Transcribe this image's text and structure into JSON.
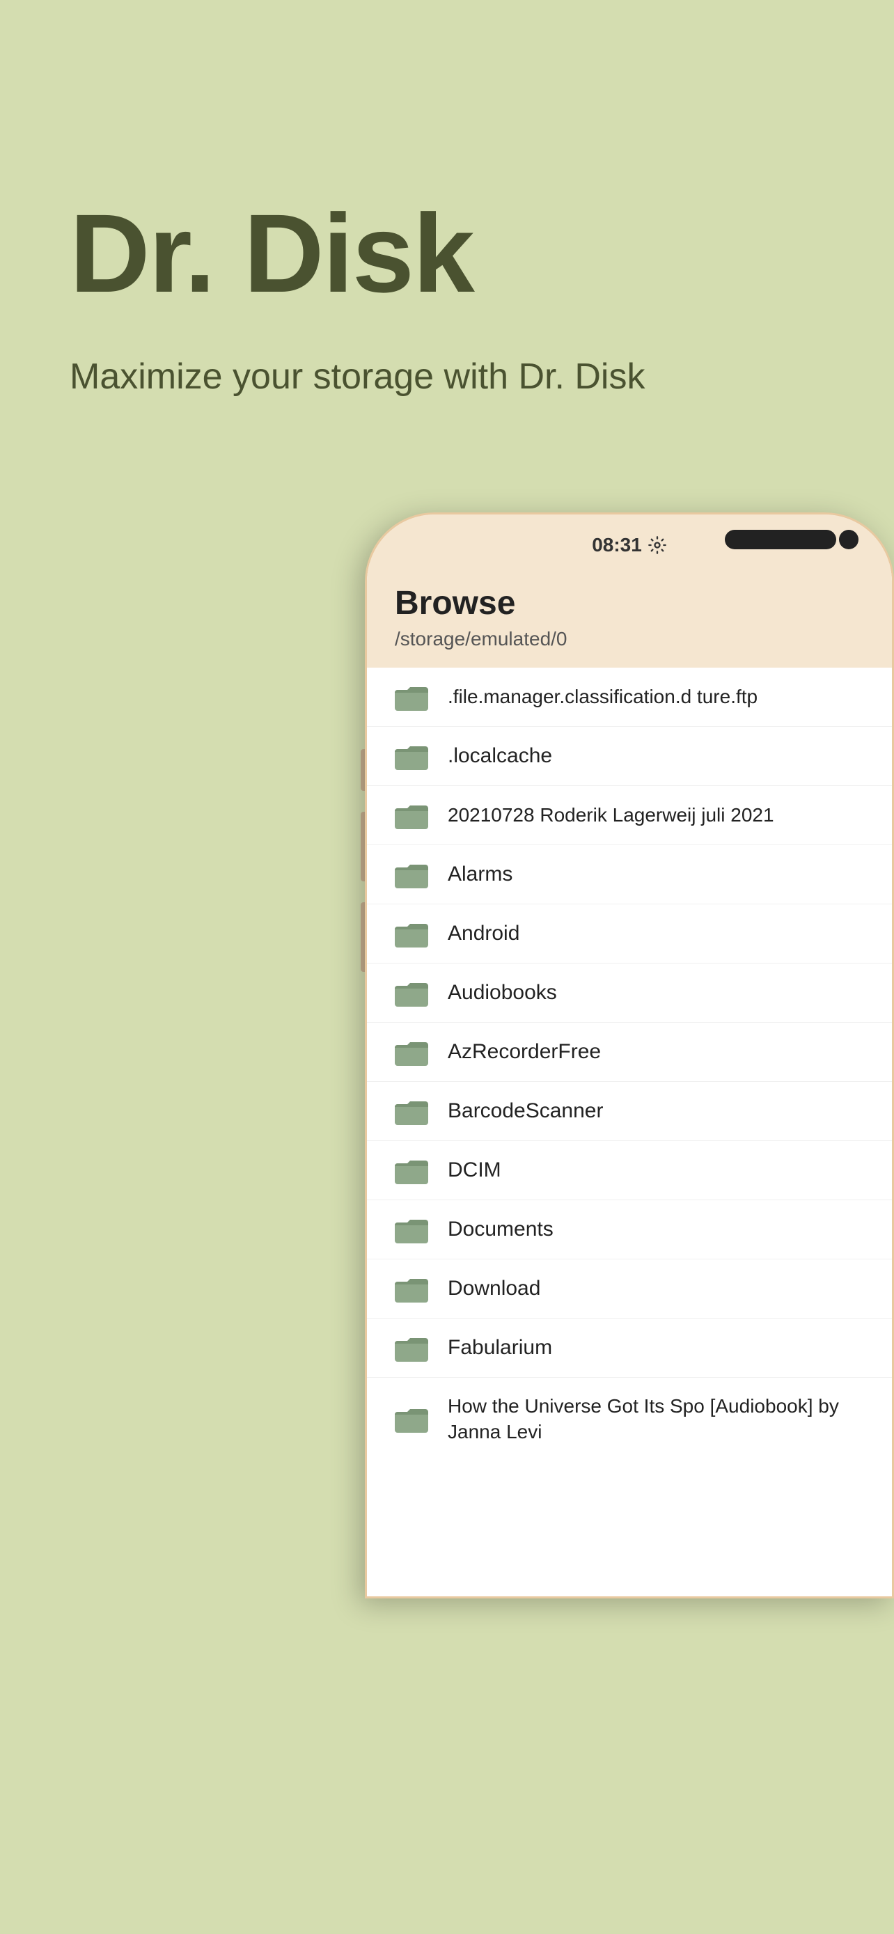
{
  "hero": {
    "title": "Dr. Disk",
    "subtitle": "Maximize your storage with Dr. Disk"
  },
  "phone": {
    "status_time": "08:31",
    "screen": {
      "browse_title": "Browse",
      "browse_path": "/storage/emulated/0",
      "files": [
        {
          "name": ".file.manager.classification.d\nture.ftp",
          "multiline": true
        },
        {
          "name": ".localcache",
          "multiline": false
        },
        {
          "name": "20210728 Roderik Lagerweij\njuli 2021",
          "multiline": true
        },
        {
          "name": "Alarms",
          "multiline": false
        },
        {
          "name": "Android",
          "multiline": false
        },
        {
          "name": "Audiobooks",
          "multiline": false
        },
        {
          "name": "AzRecorderFree",
          "multiline": false
        },
        {
          "name": "BarcodeScanner",
          "multiline": false
        },
        {
          "name": "DCIM",
          "multiline": false
        },
        {
          "name": "Documents",
          "multiline": false
        },
        {
          "name": "Download",
          "multiline": false
        },
        {
          "name": "Fabularium",
          "multiline": false
        },
        {
          "name": "How the Universe Got Its Spo\n[Audiobook] by Janna Levi",
          "multiline": true
        }
      ]
    }
  },
  "colors": {
    "background": "#d4ddb0",
    "title_color": "#4a5230",
    "phone_frame": "#f5e6d0",
    "folder_color": "#8fa88a"
  }
}
